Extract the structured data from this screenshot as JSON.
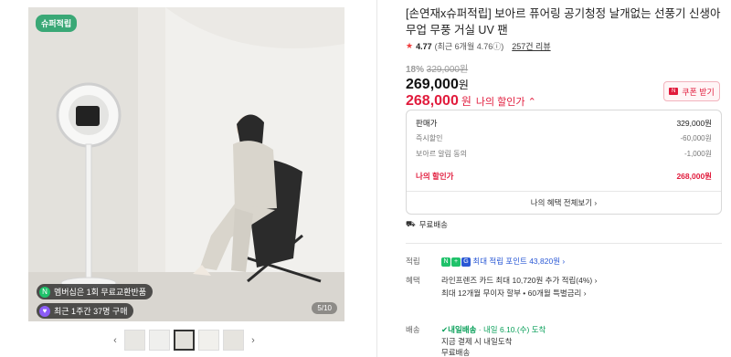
{
  "gallery": {
    "badge": "슈퍼적립",
    "pill_membership": "멤버십은 1회 무료교환반품",
    "pill_purchases": "최근 1주간 37명 구매",
    "page_counter": "5/10",
    "prev_arrow": "‹",
    "next_arrow": "›"
  },
  "product": {
    "title": "[손연재x슈퍼적립] 보아르 퓨어링 공기청정 날개없는 선풍기 신생아 무업 무풍 거실 UV 팬",
    "rating_score": "4.77",
    "rating_sub": "(최근 6개월 4.76ⓘ)",
    "reviews": "257건 리뷰",
    "discount_pct": "18%",
    "original_price": "329,000원",
    "price": "269,000",
    "price_unit": "원",
    "my_price": "268,000",
    "my_price_unit": "원",
    "my_price_label": "나의 할인가 ⌃",
    "coupon_button": "쿠폰 받기"
  },
  "breakdown": {
    "rows": [
      {
        "label": "판매가",
        "value": "329,000원"
      },
      {
        "label": "즉시할인",
        "value": "-60,000원"
      },
      {
        "label": "보아르 알림 동의",
        "value": "-1,000원"
      }
    ],
    "my_label": "나의 할인가",
    "my_value": "268,000원",
    "all_benefits": "나의 혜택 전체보기 ›"
  },
  "shipping_free": "무료배송",
  "points": {
    "label": "적립",
    "text": "최대 적립 포인트 43,820원 ›"
  },
  "benefit": {
    "label": "혜택",
    "line1": "라인프렌즈 카드 최대 10,720원 추가 적립(4%) ›",
    "line2": "최대 12개월 무이자 할부 • 60개월 특별금리 ›"
  },
  "delivery": {
    "label": "배송",
    "tag": "내일배송",
    "line1_rest": "· 내일 6.10.(수) 도착",
    "line2": "지금 결제 시 내일도착",
    "line3": "무료배송"
  }
}
